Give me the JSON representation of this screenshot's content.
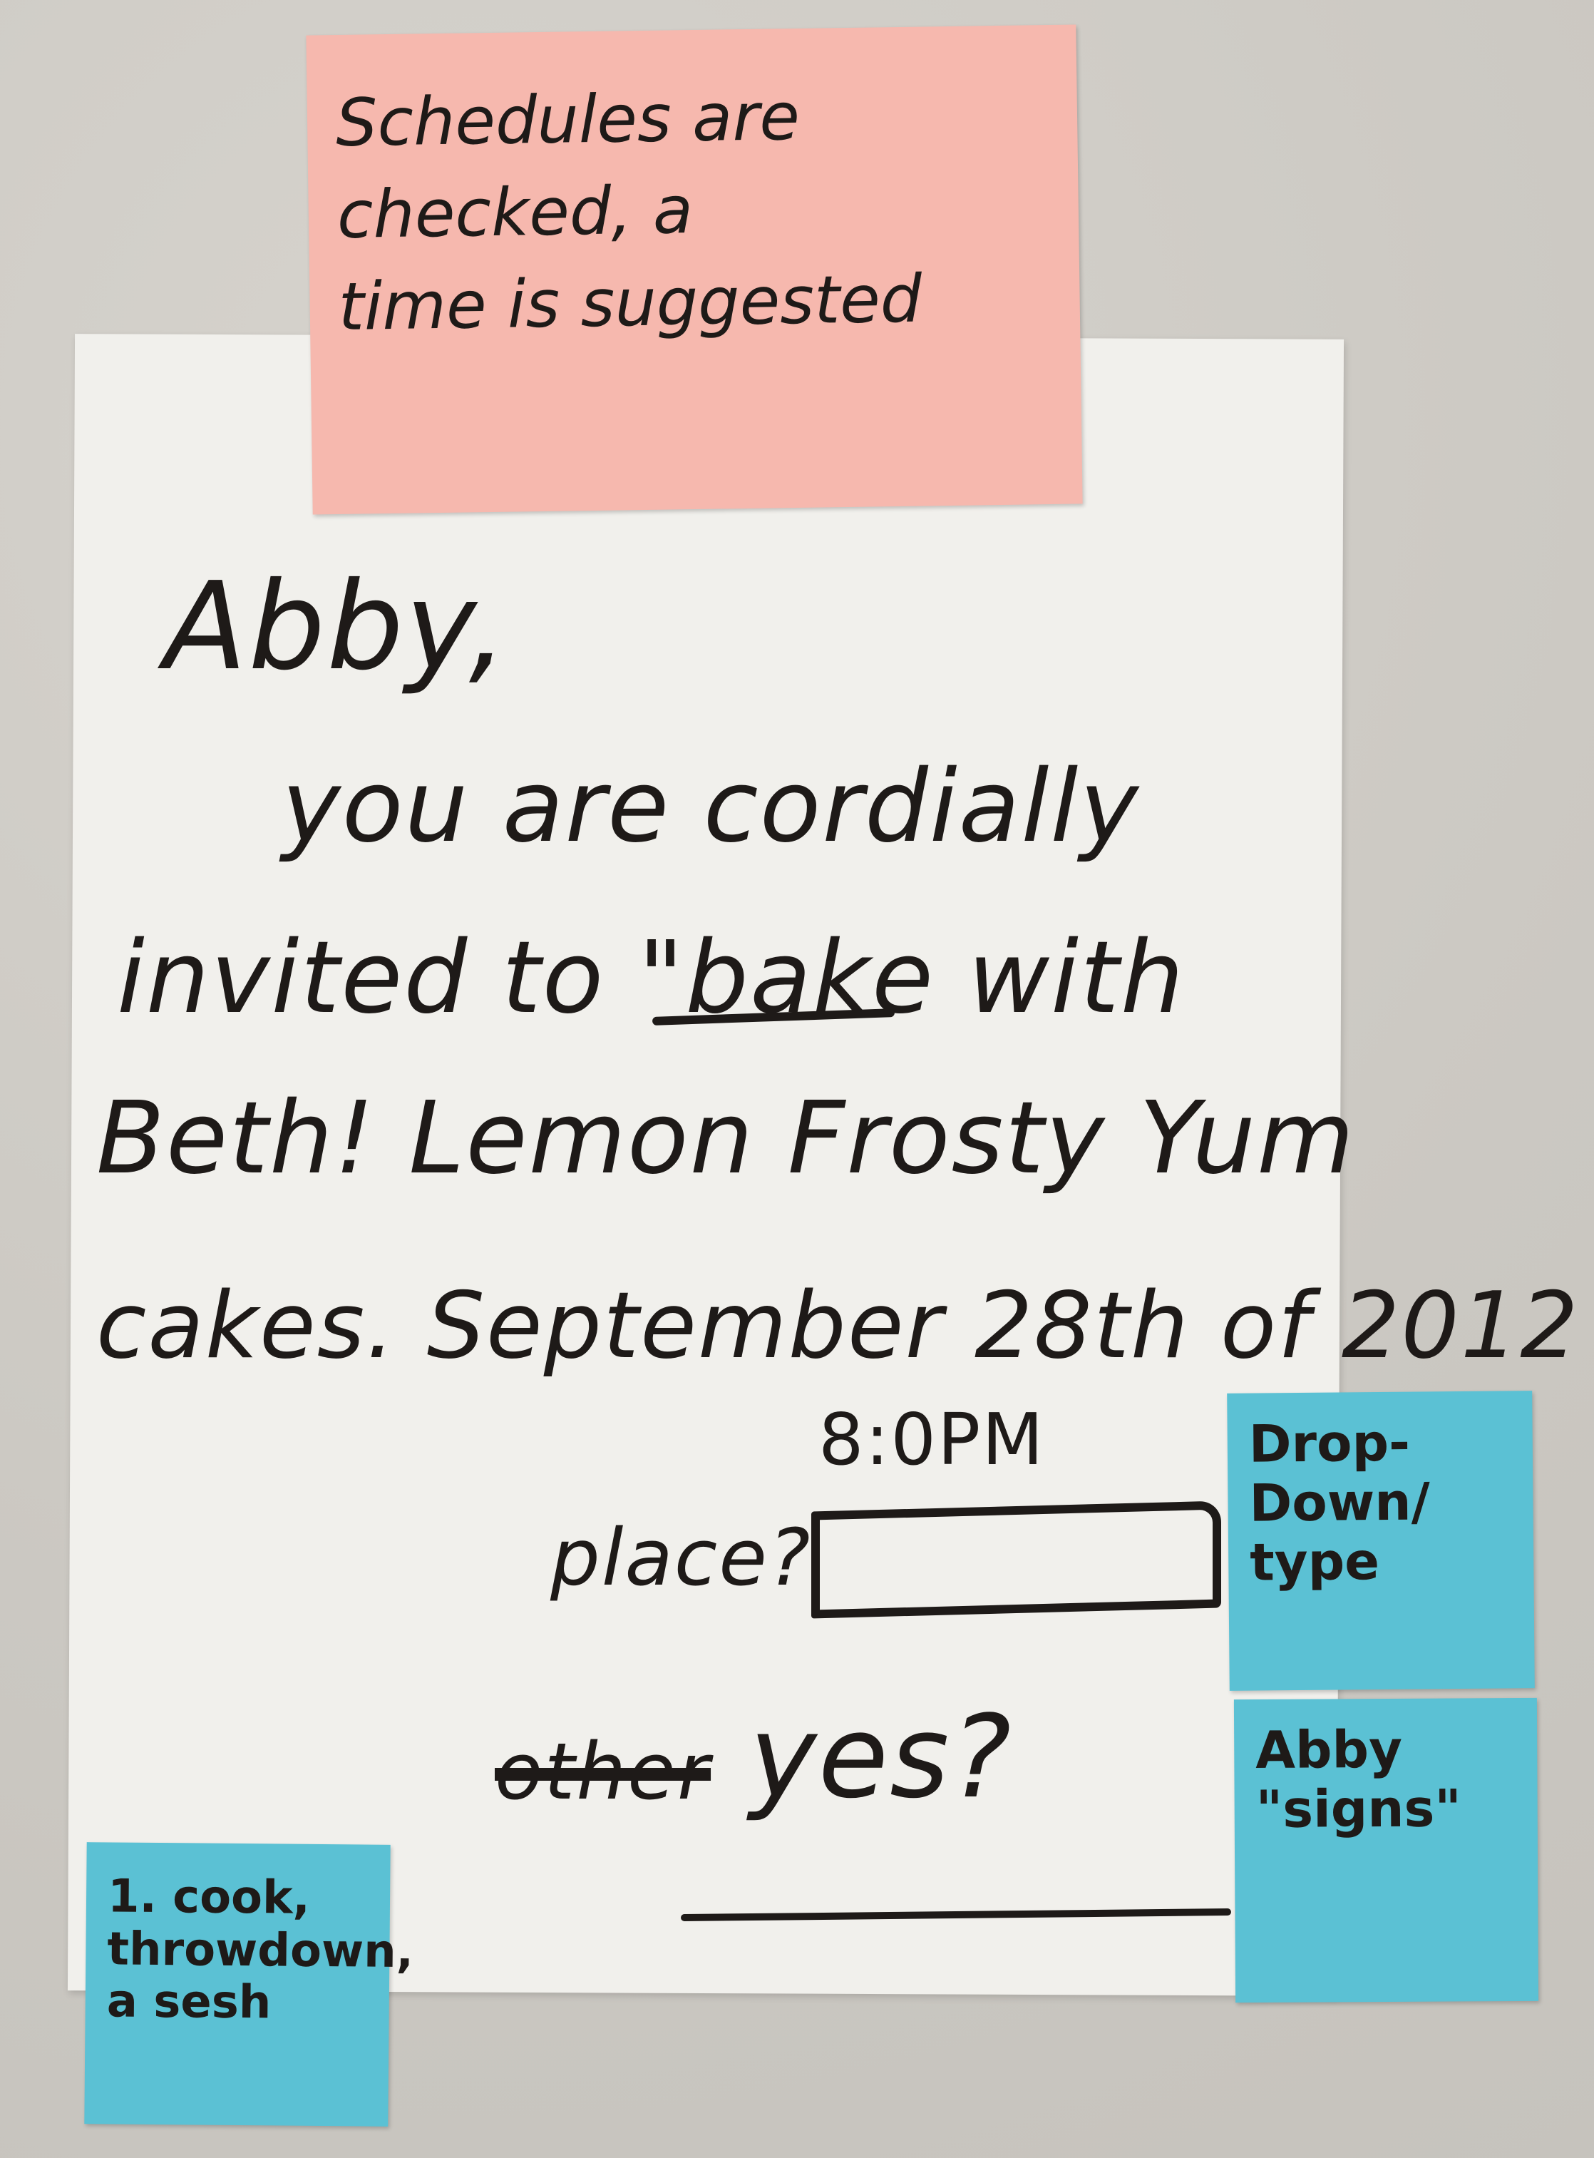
{
  "colors": {
    "paper": "#f1f0ec",
    "pink_note": "#f6b8ae",
    "blue_note": "#5bc1d4",
    "ink": "#1e1a18"
  },
  "pink_note": {
    "text": "Schedules are\nchecked, a\ntime is suggested"
  },
  "invitation": {
    "greeting": "Abby,",
    "line1": "you are cordially",
    "line2": "invited to \"bake with",
    "line3": "Beth! Lemon Frosty Yum",
    "line4": "cakes. September 28th of 2012",
    "time": "8:0PM",
    "place_label": "place?",
    "place_value": "",
    "crossed_out_word": "other",
    "confirm_label": "yes?"
  },
  "sticky_notes": [
    {
      "text": "Drop-\nDown/\ntype"
    },
    {
      "text": "Abby\n\"signs\""
    },
    {
      "text": "1. cook,\nthrowdown,\na sesh"
    }
  ]
}
